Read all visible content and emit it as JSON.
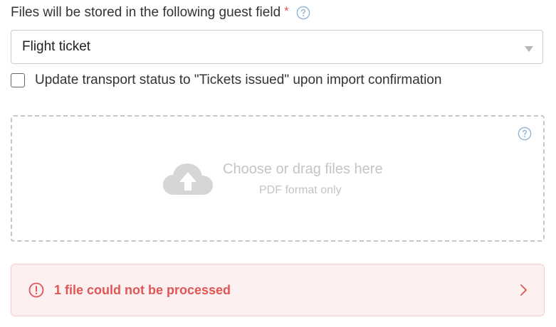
{
  "guest_field": {
    "label": "Files will be stored in the following guest field",
    "required_mark": "*",
    "help_icon": "question-circle-icon",
    "selected_value": "Flight ticket",
    "arrow_icon": "caret-down-icon"
  },
  "update_status": {
    "label": "Update transport status to \"Tickets issued\" upon import confirmation",
    "checked": false
  },
  "dropzone": {
    "title": "Choose or drag files here",
    "subtitle": "PDF format only",
    "upload_icon": "cloud-upload-icon",
    "help_icon": "question-circle-icon"
  },
  "error_banner": {
    "text": "1 file could not be processed",
    "icon": "exclamation-circle-icon",
    "chevron_icon": "chevron-right-icon"
  },
  "colors": {
    "error_text": "#e05555",
    "error_bg": "#fdf0f0",
    "help_blue": "#8fb4d6",
    "required_red": "#e05a5a",
    "placeholder_gray": "#c4c4c4"
  }
}
